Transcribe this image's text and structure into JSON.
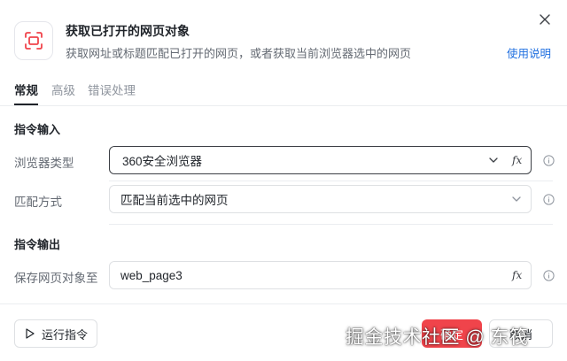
{
  "header": {
    "title": "获取已打开的网页对象",
    "subtitle": "获取网址或标题匹配已打开的网页，或者获取当前浏览器选中的网页",
    "help_link": "使用说明",
    "icon": "browser-target-icon",
    "icon_color": "#f0444b"
  },
  "tabs": [
    {
      "label": "常规",
      "active": true
    },
    {
      "label": "高级",
      "active": false
    },
    {
      "label": "错误处理",
      "active": false
    }
  ],
  "input_section": {
    "title": "指令输入",
    "browser_type": {
      "label": "浏览器类型",
      "value": "360安全浏览器"
    },
    "match_mode": {
      "label": "匹配方式",
      "value": "匹配当前选中的网页"
    }
  },
  "output_section": {
    "title": "指令输出",
    "save_object": {
      "label": "保存网页对象至",
      "value": "web_page3"
    }
  },
  "fx_label": "fx",
  "footer": {
    "run_label": "运行指令",
    "confirm_label": "确定",
    "cancel_label": "取消"
  },
  "watermark": "掘金技术社区 @ 东筏",
  "colors": {
    "accent": "#f0444b",
    "link": "#1f6fe0"
  }
}
